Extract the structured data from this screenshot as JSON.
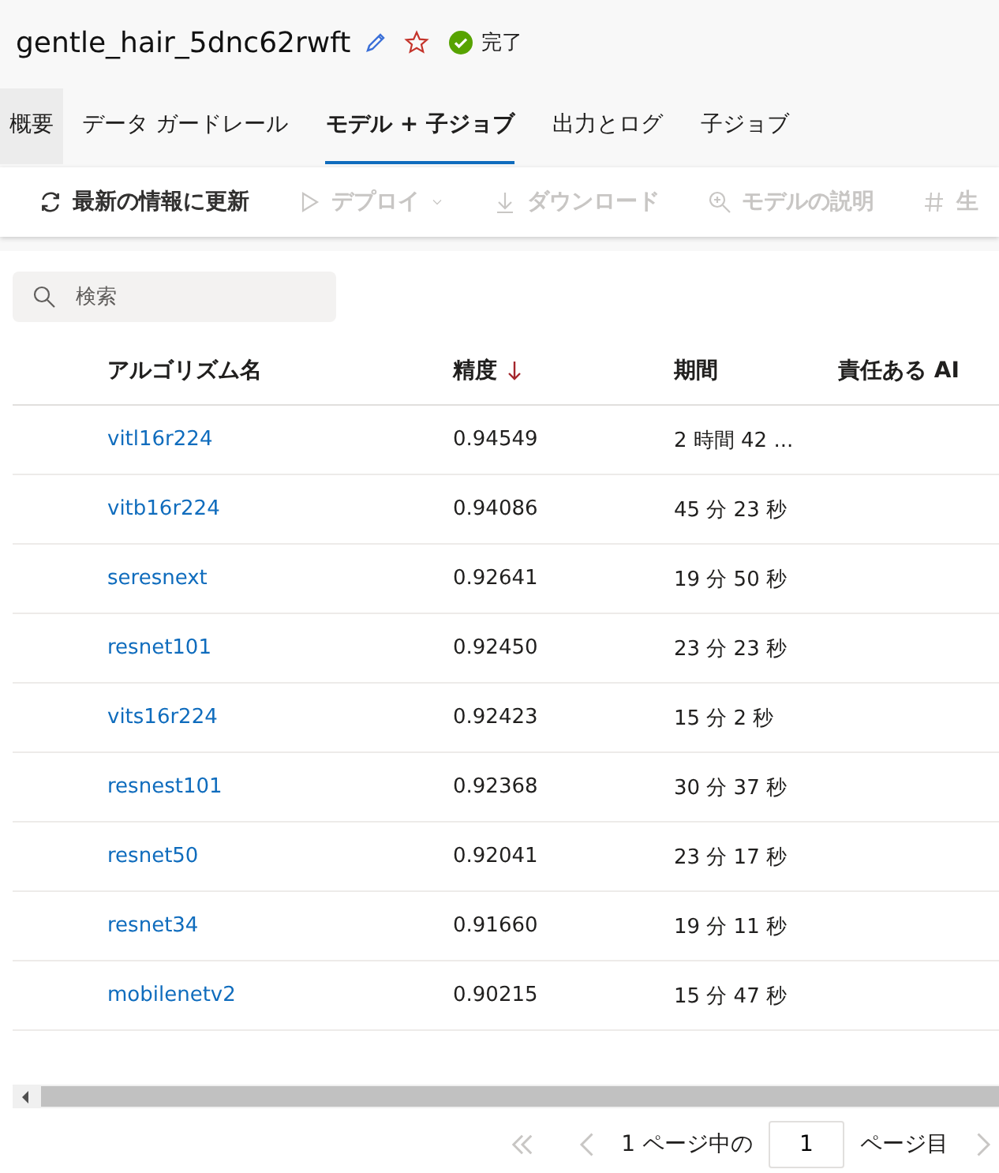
{
  "header": {
    "title": "gentle_hair_5dnc62rwft",
    "status": "完了"
  },
  "tabs": [
    {
      "label": "概要",
      "selected": false,
      "hovered": true
    },
    {
      "label": "データ ガードレール",
      "selected": false,
      "hovered": false
    },
    {
      "label": "モデル + 子ジョブ",
      "selected": true,
      "hovered": false
    },
    {
      "label": "出力とログ",
      "selected": false,
      "hovered": false
    },
    {
      "label": "子ジョブ",
      "selected": false,
      "hovered": false
    }
  ],
  "toolbar": [
    {
      "kind": "refresh",
      "label": "最新の情報に更新",
      "disabled": false
    },
    {
      "kind": "deploy",
      "label": "デプロイ",
      "disabled": true
    },
    {
      "kind": "download",
      "label": "ダウンロード",
      "disabled": true
    },
    {
      "kind": "explain",
      "label": "モデルの説明",
      "disabled": true
    },
    {
      "kind": "hash",
      "label": "生",
      "disabled": true
    }
  ],
  "search": {
    "placeholder": "検索"
  },
  "table": {
    "columns": [
      {
        "label": "アルゴリズム名",
        "sorted": false
      },
      {
        "label": "精度",
        "sorted": true
      },
      {
        "label": "期間",
        "sorted": false
      },
      {
        "label": "責任ある AI",
        "sorted": false
      }
    ],
    "rows": [
      [
        "vitl16r224",
        "0.94549",
        "2 時間 42 ..."
      ],
      [
        "vitb16r224",
        "0.94086",
        "45 分 23 秒"
      ],
      [
        "seresnext",
        "0.92641",
        "19 分 50 秒"
      ],
      [
        "resnet101",
        "0.92450",
        "23 分 23 秒"
      ],
      [
        "vits16r224",
        "0.92423",
        "15 分 2 秒"
      ],
      [
        "resnest101",
        "0.92368",
        "30 分 37 秒"
      ],
      [
        "resnet50",
        "0.92041",
        "23 分 17 秒"
      ],
      [
        "resnet34",
        "0.91660",
        "19 分 11 秒"
      ],
      [
        "mobilenetv2",
        "0.90215",
        "15 分 47 秒"
      ]
    ]
  },
  "pagination": {
    "before": "1 ページ中の",
    "page": "1",
    "after": "ページ目"
  }
}
